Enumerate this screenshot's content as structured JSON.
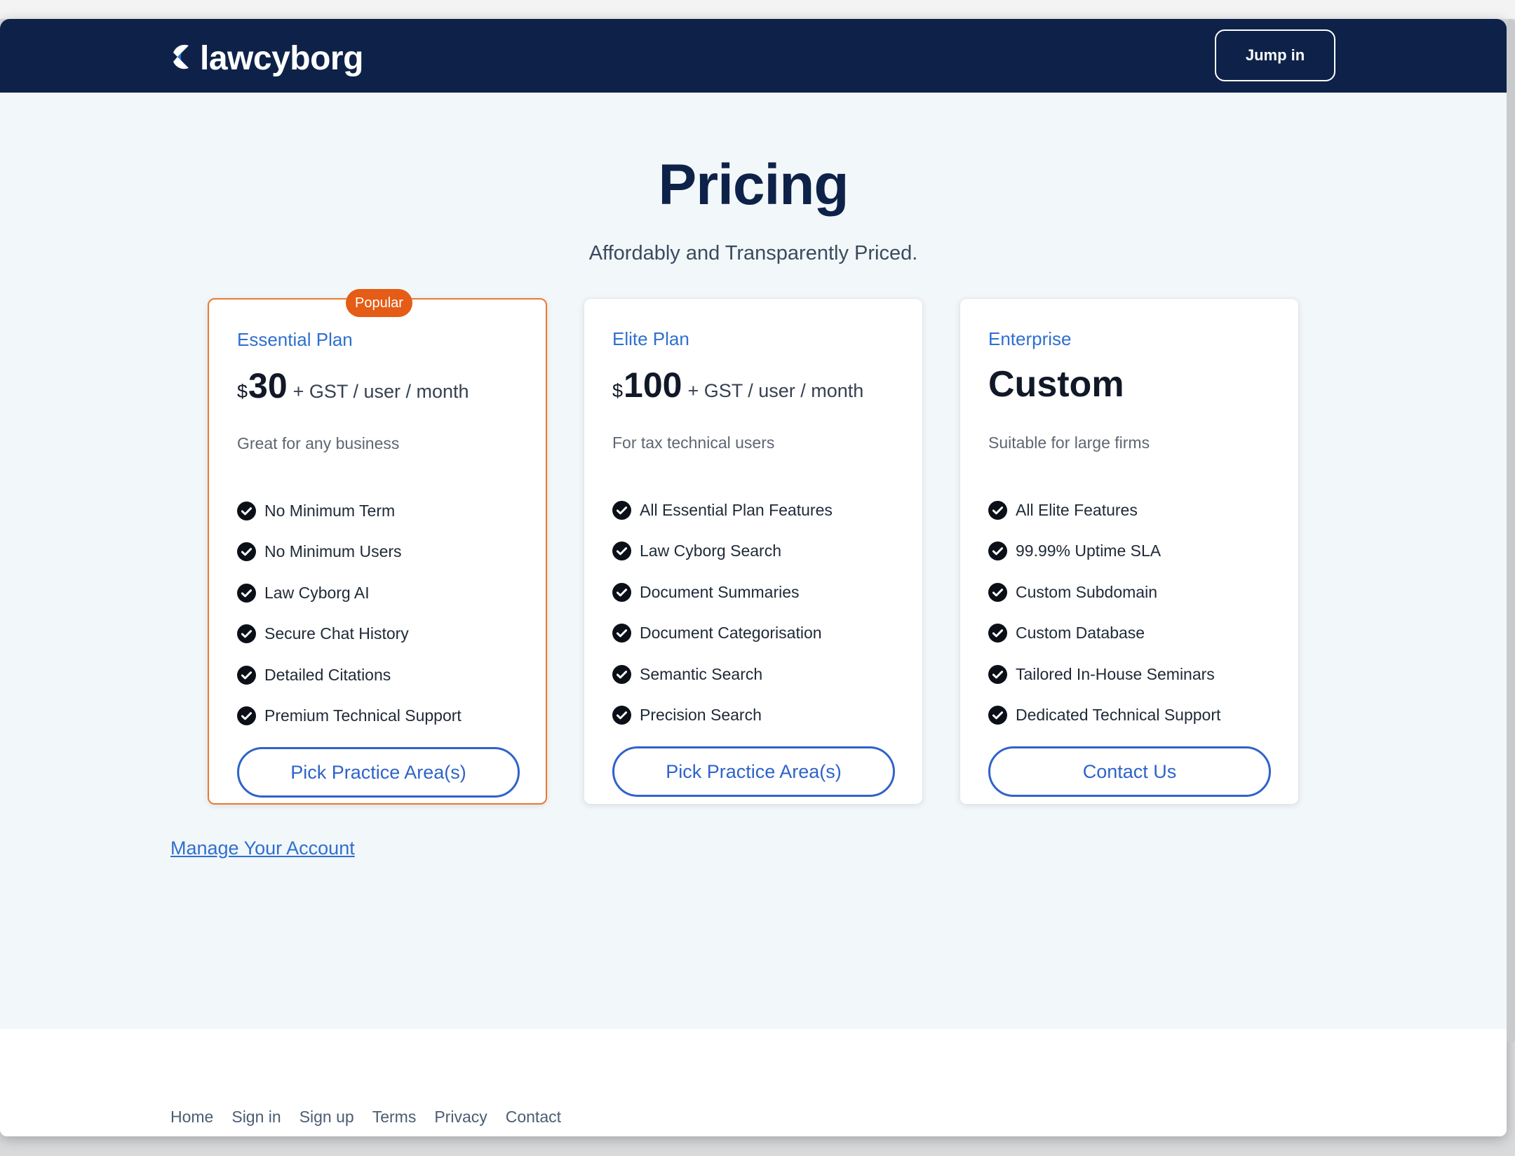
{
  "header": {
    "logo_text": "lawcyborg",
    "jump_in_label": "Jump in"
  },
  "hero": {
    "title": "Pricing",
    "subtitle": "Affordably and Transparently Priced."
  },
  "plans": [
    {
      "badge": "Popular",
      "name": "Essential Plan",
      "currency": "$",
      "amount": "30",
      "suffix": "+ GST / user / month",
      "tagline": "Great for any business",
      "features": [
        "No Minimum Term",
        "No Minimum Users",
        "Law Cyborg AI",
        "Secure Chat History",
        "Detailed Citations",
        "Premium Technical Support"
      ],
      "cta": "Pick Practice Area(s)"
    },
    {
      "name": "Elite Plan",
      "currency": "$",
      "amount": "100",
      "suffix": "+ GST / user / month",
      "tagline": "For tax technical users",
      "features": [
        "All Essential Plan Features",
        "Law Cyborg Search",
        "Document Summaries",
        "Document Categorisation",
        "Semantic Search",
        "Precision Search"
      ],
      "cta": "Pick Practice Area(s)"
    },
    {
      "name": "Enterprise",
      "price_text": "Custom",
      "tagline": "Suitable for large firms",
      "features": [
        "All Elite Features",
        "99.99% Uptime SLA",
        "Custom Subdomain",
        "Custom Database",
        "Tailored In-House Seminars",
        "Dedicated Technical Support"
      ],
      "cta": "Contact Us"
    }
  ],
  "manage_account_label": "Manage Your Account",
  "footer": {
    "links": [
      "Home",
      "Sign in",
      "Sign up",
      "Terms",
      "Privacy",
      "Contact"
    ]
  },
  "colors": {
    "navbar": "#0e2249",
    "accent_blue": "#2f63c9",
    "popular_orange": "#e45c16"
  },
  "icons": {
    "feature_bullet": "check-circle-icon",
    "logo_mark": "lawcyborg-logo-icon"
  }
}
